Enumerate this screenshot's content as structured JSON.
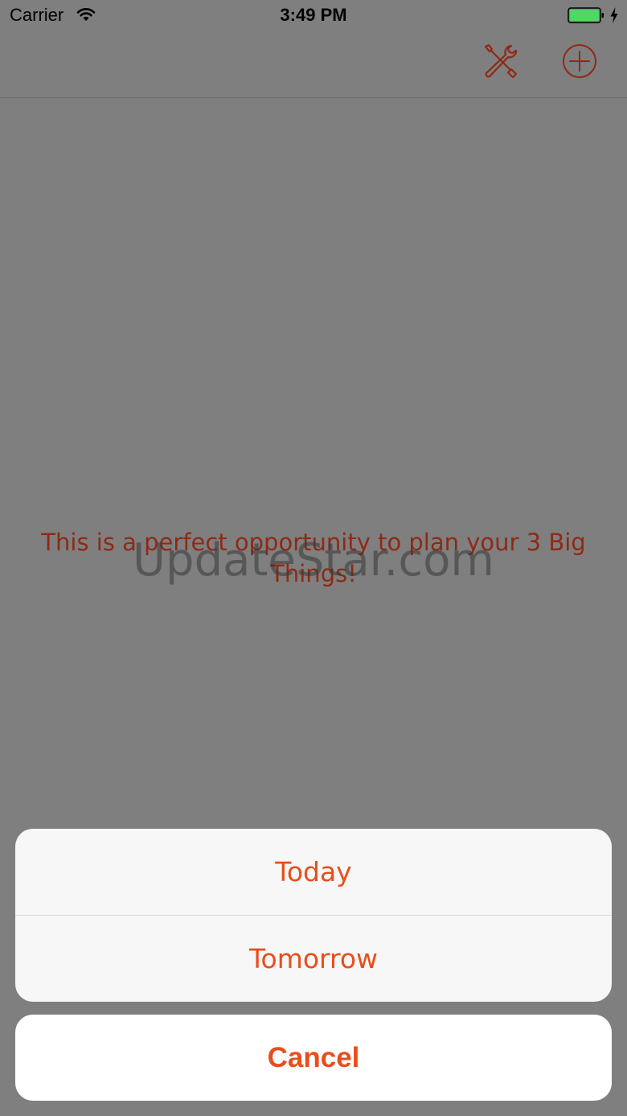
{
  "status_bar": {
    "carrier": "Carrier",
    "time": "3:49 PM",
    "wifi_icon": "wifi-icon",
    "battery_icon": "battery-icon",
    "battery_level": 1.0,
    "battery_color": "#4cd964",
    "charging_icon": "lightning-icon"
  },
  "nav_bar": {
    "tools_icon": "tools-icon",
    "add_icon": "plus-circle-icon",
    "accent_color": "#e84e1d"
  },
  "main": {
    "message": "This is a perfect opportunity to plan your 3 Big Things!",
    "watermark": "UpdateStar.com"
  },
  "action_sheet": {
    "options": [
      "Today",
      "Tomorrow"
    ],
    "cancel_label": "Cancel"
  }
}
